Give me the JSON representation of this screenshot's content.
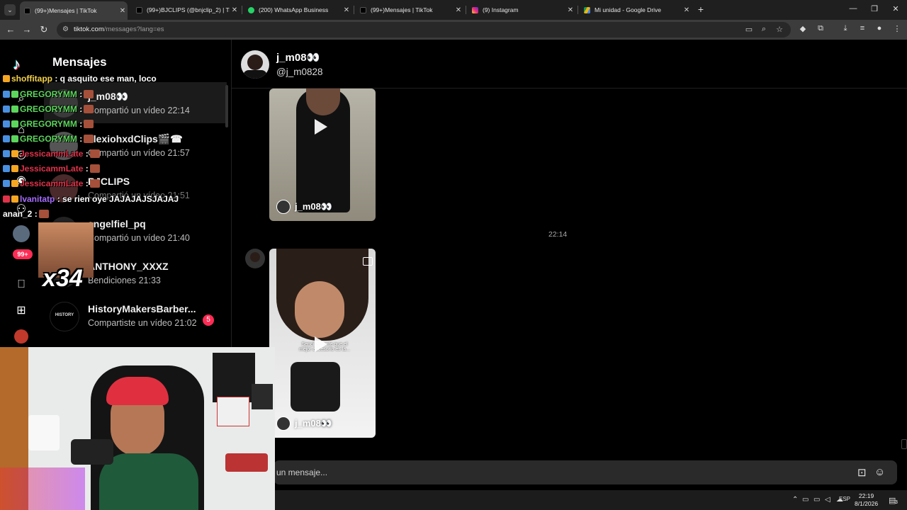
{
  "browser": {
    "tabs": [
      {
        "title": "(99+)Mensajes | TikTok",
        "favicon": "tiktok-icon",
        "active": true
      },
      {
        "title": "(99+)BJCLIPS (@bnjclip_2) | TikT",
        "favicon": "tiktok-icon",
        "active": false
      },
      {
        "title": "(200) WhatsApp Business",
        "favicon": "whatsapp-icon",
        "active": false
      },
      {
        "title": "(99+)Mensajes | TikTok",
        "favicon": "tiktok-icon",
        "active": false
      },
      {
        "title": "(9) Instagram",
        "favicon": "instagram-icon",
        "active": false
      },
      {
        "title": "Mi unidad - Google Drive",
        "favicon": "drive-icon",
        "active": false
      }
    ],
    "close_glyph": "✕",
    "new_tab_glyph": "+",
    "url_host": "tiktok.com",
    "url_path": "/messages?lang=es"
  },
  "tiktok": {
    "page_title": "Mensajes",
    "conversations": [
      {
        "name": "j_m08👀",
        "preview": "Compartió un vídeo 22:14",
        "selected": true
      },
      {
        "name": "alexiohxdClips🎬☎",
        "preview": "Compartió un vídeo 21:57",
        "selected": false
      },
      {
        "name": "BJCLIPS",
        "preview": "Compartió un vídeo 21:51",
        "selected": false
      },
      {
        "name": "angelfiel_pq",
        "preview": "Compartió un vídeo 21:40",
        "selected": false
      },
      {
        "name": "ANTHONY_XXXZ",
        "preview": "Bendiciones 21:33",
        "selected": false
      },
      {
        "name": "HistoryMakersBarber...",
        "preview": "Compartiste un vídeo 21:02",
        "selected": false,
        "badge": "5"
      }
    ],
    "notification_badge": "99+",
    "chat": {
      "name": "j_m08👀",
      "handle": "@j_m0828",
      "timestamp": "22:14",
      "videos": [
        {
          "owner": "j_m08👀"
        },
        {
          "owner": "j_m08👀",
          "caption": "Sencillamente que el mejor accesorio es la..."
        }
      ],
      "composer_placeholder": "un mensaje..."
    }
  },
  "stream_chat": [
    {
      "user": "shoffitapp",
      "text": ": q asquito ese man, loco",
      "color": "#f5d24a"
    },
    {
      "user": "GREGORYMM",
      "text": ":",
      "color": "#5cd65c",
      "emote": true
    },
    {
      "user": "GREGORYMM",
      "text": ":",
      "color": "#5cd65c",
      "emote": true
    },
    {
      "user": "GREGORYMM",
      "text": ":",
      "color": "#5cd65c",
      "emote": true
    },
    {
      "user": "GREGORYMM",
      "text": ":",
      "color": "#5cd65c",
      "emote": true
    },
    {
      "user": "JessicammLate",
      "text": ":",
      "color": "#e0334a",
      "emote": true
    },
    {
      "user": "JessicammLate",
      "text": ":",
      "color": "#e0334a",
      "emote": true
    },
    {
      "user": "JessicammLate",
      "text": ":",
      "color": "#e0334a",
      "emote": true
    },
    {
      "user": "lvanitatp",
      "text": ": se rien oye JAJAJAJSJAJAJ",
      "color": "#a66cff"
    },
    {
      "user": "anan_2",
      "text": ":",
      "color": "#ffffff",
      "emote": true
    }
  ],
  "emote_multiplier": "x34",
  "taskbar": {
    "language": "ESP",
    "time": "22:19",
    "date": "8/1/2026",
    "notification_count": "3"
  },
  "colors": {
    "accent": "#fe2c55",
    "tiktok_cyan": "#25f4ee"
  }
}
